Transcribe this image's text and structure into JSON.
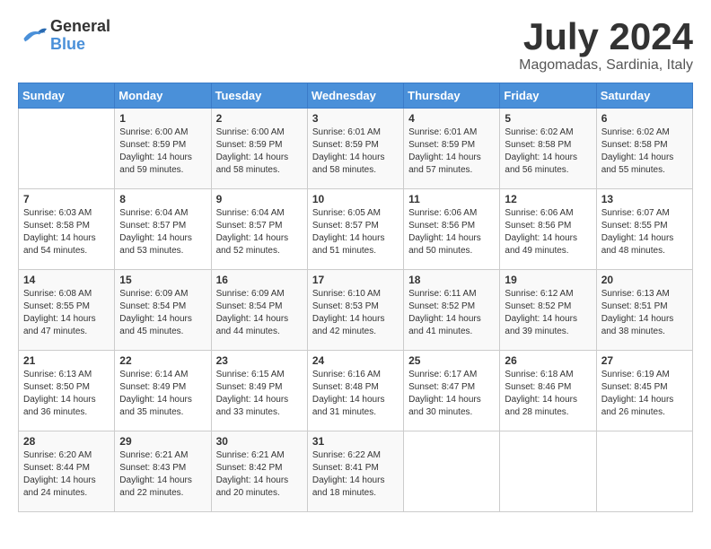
{
  "header": {
    "logo_general": "General",
    "logo_blue": "Blue",
    "month_title": "July 2024",
    "location": "Magomadas, Sardinia, Italy"
  },
  "calendar": {
    "days_of_week": [
      "Sunday",
      "Monday",
      "Tuesday",
      "Wednesday",
      "Thursday",
      "Friday",
      "Saturday"
    ],
    "weeks": [
      [
        {
          "day": "",
          "info": ""
        },
        {
          "day": "1",
          "info": "Sunrise: 6:00 AM\nSunset: 8:59 PM\nDaylight: 14 hours\nand 59 minutes."
        },
        {
          "day": "2",
          "info": "Sunrise: 6:00 AM\nSunset: 8:59 PM\nDaylight: 14 hours\nand 58 minutes."
        },
        {
          "day": "3",
          "info": "Sunrise: 6:01 AM\nSunset: 8:59 PM\nDaylight: 14 hours\nand 58 minutes."
        },
        {
          "day": "4",
          "info": "Sunrise: 6:01 AM\nSunset: 8:59 PM\nDaylight: 14 hours\nand 57 minutes."
        },
        {
          "day": "5",
          "info": "Sunrise: 6:02 AM\nSunset: 8:58 PM\nDaylight: 14 hours\nand 56 minutes."
        },
        {
          "day": "6",
          "info": "Sunrise: 6:02 AM\nSunset: 8:58 PM\nDaylight: 14 hours\nand 55 minutes."
        }
      ],
      [
        {
          "day": "7",
          "info": "Sunrise: 6:03 AM\nSunset: 8:58 PM\nDaylight: 14 hours\nand 54 minutes."
        },
        {
          "day": "8",
          "info": "Sunrise: 6:04 AM\nSunset: 8:57 PM\nDaylight: 14 hours\nand 53 minutes."
        },
        {
          "day": "9",
          "info": "Sunrise: 6:04 AM\nSunset: 8:57 PM\nDaylight: 14 hours\nand 52 minutes."
        },
        {
          "day": "10",
          "info": "Sunrise: 6:05 AM\nSunset: 8:57 PM\nDaylight: 14 hours\nand 51 minutes."
        },
        {
          "day": "11",
          "info": "Sunrise: 6:06 AM\nSunset: 8:56 PM\nDaylight: 14 hours\nand 50 minutes."
        },
        {
          "day": "12",
          "info": "Sunrise: 6:06 AM\nSunset: 8:56 PM\nDaylight: 14 hours\nand 49 minutes."
        },
        {
          "day": "13",
          "info": "Sunrise: 6:07 AM\nSunset: 8:55 PM\nDaylight: 14 hours\nand 48 minutes."
        }
      ],
      [
        {
          "day": "14",
          "info": "Sunrise: 6:08 AM\nSunset: 8:55 PM\nDaylight: 14 hours\nand 47 minutes."
        },
        {
          "day": "15",
          "info": "Sunrise: 6:09 AM\nSunset: 8:54 PM\nDaylight: 14 hours\nand 45 minutes."
        },
        {
          "day": "16",
          "info": "Sunrise: 6:09 AM\nSunset: 8:54 PM\nDaylight: 14 hours\nand 44 minutes."
        },
        {
          "day": "17",
          "info": "Sunrise: 6:10 AM\nSunset: 8:53 PM\nDaylight: 14 hours\nand 42 minutes."
        },
        {
          "day": "18",
          "info": "Sunrise: 6:11 AM\nSunset: 8:52 PM\nDaylight: 14 hours\nand 41 minutes."
        },
        {
          "day": "19",
          "info": "Sunrise: 6:12 AM\nSunset: 8:52 PM\nDaylight: 14 hours\nand 39 minutes."
        },
        {
          "day": "20",
          "info": "Sunrise: 6:13 AM\nSunset: 8:51 PM\nDaylight: 14 hours\nand 38 minutes."
        }
      ],
      [
        {
          "day": "21",
          "info": "Sunrise: 6:13 AM\nSunset: 8:50 PM\nDaylight: 14 hours\nand 36 minutes."
        },
        {
          "day": "22",
          "info": "Sunrise: 6:14 AM\nSunset: 8:49 PM\nDaylight: 14 hours\nand 35 minutes."
        },
        {
          "day": "23",
          "info": "Sunrise: 6:15 AM\nSunset: 8:49 PM\nDaylight: 14 hours\nand 33 minutes."
        },
        {
          "day": "24",
          "info": "Sunrise: 6:16 AM\nSunset: 8:48 PM\nDaylight: 14 hours\nand 31 minutes."
        },
        {
          "day": "25",
          "info": "Sunrise: 6:17 AM\nSunset: 8:47 PM\nDaylight: 14 hours\nand 30 minutes."
        },
        {
          "day": "26",
          "info": "Sunrise: 6:18 AM\nSunset: 8:46 PM\nDaylight: 14 hours\nand 28 minutes."
        },
        {
          "day": "27",
          "info": "Sunrise: 6:19 AM\nSunset: 8:45 PM\nDaylight: 14 hours\nand 26 minutes."
        }
      ],
      [
        {
          "day": "28",
          "info": "Sunrise: 6:20 AM\nSunset: 8:44 PM\nDaylight: 14 hours\nand 24 minutes."
        },
        {
          "day": "29",
          "info": "Sunrise: 6:21 AM\nSunset: 8:43 PM\nDaylight: 14 hours\nand 22 minutes."
        },
        {
          "day": "30",
          "info": "Sunrise: 6:21 AM\nSunset: 8:42 PM\nDaylight: 14 hours\nand 20 minutes."
        },
        {
          "day": "31",
          "info": "Sunrise: 6:22 AM\nSunset: 8:41 PM\nDaylight: 14 hours\nand 18 minutes."
        },
        {
          "day": "",
          "info": ""
        },
        {
          "day": "",
          "info": ""
        },
        {
          "day": "",
          "info": ""
        }
      ]
    ]
  }
}
